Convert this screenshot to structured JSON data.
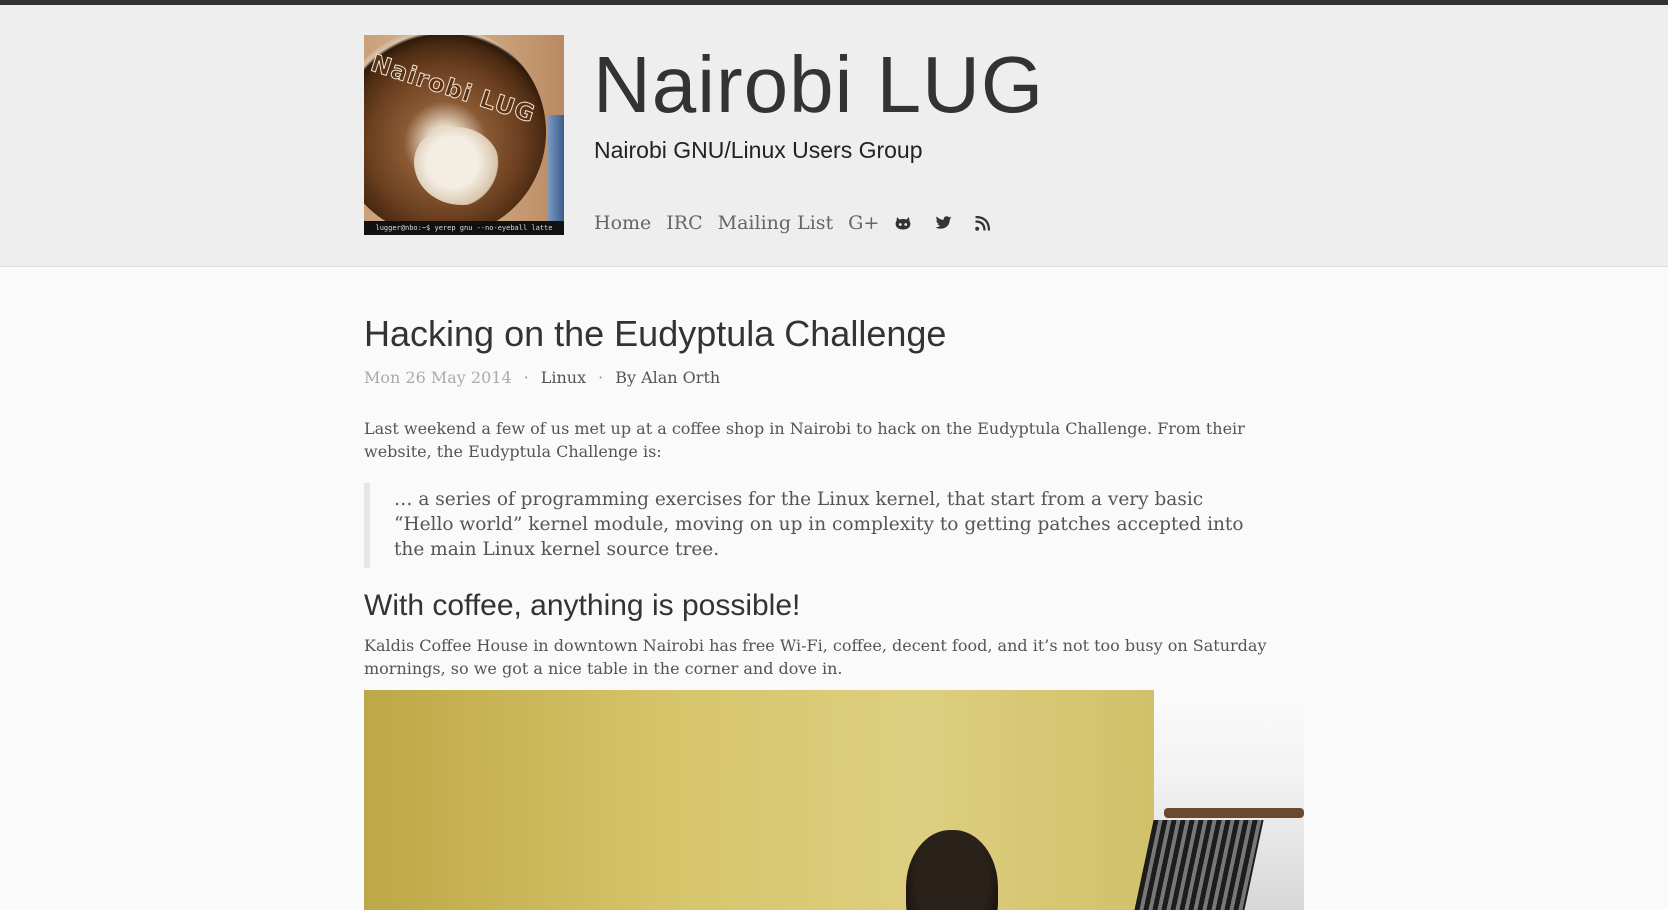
{
  "site": {
    "title": "Nairobi LUG",
    "subtitle": "Nairobi GNU/Linux Users Group",
    "logo_text": "Nairobi LUG",
    "logo_caption": "lugger@nbo:~$ yerep gnu --no-eyeball latte"
  },
  "nav": {
    "items": [
      {
        "label": "Home"
      },
      {
        "label": "IRC"
      },
      {
        "label": "Mailing List"
      },
      {
        "label": "G+"
      }
    ],
    "icons": [
      "github-icon",
      "twitter-icon",
      "rss-icon"
    ]
  },
  "post": {
    "title": "Hacking on the Eudyptula Challenge",
    "date": "Mon 26 May 2014",
    "category": "Linux",
    "author": "By Alan Orth",
    "intro": "Last weekend a few of us met up at a coffee shop in Nairobi to hack on the Eudyptula Challenge. From their website, the Eudyptula Challenge is:",
    "quote": "… a series of programming exercises for the Linux kernel, that start from a very basic “Hello world” kernel module, moving on up in complexity to getting patches accepted into the main Linux kernel source tree.",
    "section_heading": "With coffee, anything is possible!",
    "section_text": "Kaldis Coffee House in downtown Nairobi has free Wi-Fi, coffee, decent food, and it’s not too busy on Saturday mornings, so we got a nice table in the corner and dove in."
  }
}
